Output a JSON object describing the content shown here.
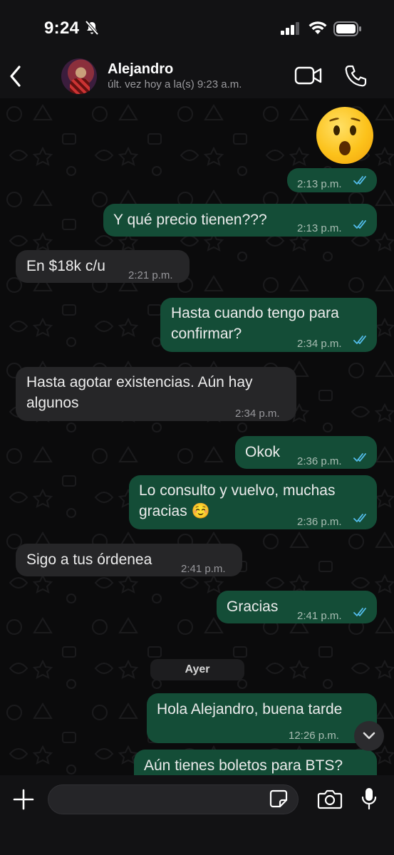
{
  "status_bar": {
    "time": "9:24"
  },
  "header": {
    "contact_name": "Alejandro",
    "last_seen": "últ. vez hoy a la(s) 9:23 a.m."
  },
  "messages": [
    {
      "id": "m0",
      "direction": "out",
      "emoji": "astonished-face",
      "time": "2:13 p.m.",
      "status": "read"
    },
    {
      "id": "m1",
      "direction": "out",
      "text": "Y qué precio tienen???",
      "time": "2:13 p.m.",
      "status": "read"
    },
    {
      "id": "m2",
      "direction": "in",
      "text": "En $18k c/u",
      "time": "2:21 p.m."
    },
    {
      "id": "m3",
      "direction": "out",
      "lines": [
        "Hasta cuando tengo para",
        "confirmar?"
      ],
      "time": "2:34 p.m.",
      "status": "read"
    },
    {
      "id": "m4",
      "direction": "in",
      "lines": [
        "Hasta agotar existencias. Aún hay",
        "algunos"
      ],
      "time": "2:34 p.m."
    },
    {
      "id": "m5",
      "direction": "out",
      "text": "Okok",
      "time": "2:36 p.m.",
      "status": "read"
    },
    {
      "id": "m6",
      "direction": "out",
      "lines": [
        "Lo consulto y vuelvo, muchas",
        "gracias ☺️"
      ],
      "time": "2:36 p.m.",
      "status": "read"
    },
    {
      "id": "m7",
      "direction": "in",
      "text": "Sigo a tus órdenea",
      "time": "2:41 p.m."
    },
    {
      "id": "m8",
      "direction": "out",
      "text": "Gracias",
      "time": "2:41 p.m.",
      "status": "read"
    },
    {
      "id": "m9",
      "direction": "out",
      "text": "Hola Alejandro, buena tarde",
      "time": "12:26 p.m.",
      "status": "read"
    },
    {
      "id": "m10",
      "direction": "out",
      "text": "Aún tienes boletos para BTS?"
    }
  ],
  "day_separator": "Ayer",
  "colors": {
    "outgoing_bubble": "#144d37",
    "incoming_bubble": "#262628",
    "read_ticks": "#53bdeb",
    "background": "#0b0b0c"
  },
  "icons": [
    "back-icon",
    "video-call-icon",
    "voice-call-icon",
    "plus-icon",
    "sticker-icon",
    "camera-icon",
    "mic-icon",
    "chevron-down-icon"
  ]
}
